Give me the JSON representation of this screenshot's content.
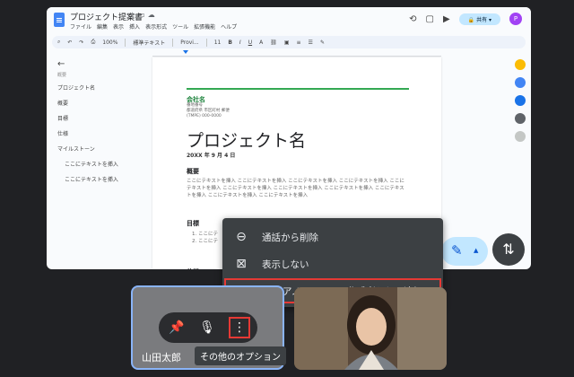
{
  "docs": {
    "title": "プロジェクト提案書",
    "menu": [
      "ファイル",
      "編集",
      "表示",
      "挿入",
      "表示形式",
      "ツール",
      "拡張機能",
      "ヘルプ"
    ],
    "share_label": "共有",
    "avatar_initial": "P",
    "toolbar": {
      "zoom": "100%",
      "style": "標準テキスト",
      "font": "Provi...",
      "font_size": "11"
    }
  },
  "outline": {
    "heading": "概要",
    "items": [
      "プロジェクト名",
      "概要",
      "目標",
      "仕様",
      "マイルストーン",
      "ここにテキストを挿入",
      "ここにテキストを挿入"
    ]
  },
  "page": {
    "company": "会社名",
    "address_lines": [
      "番地番号",
      "都道府県 市区町村 郵便",
      "(TMPE) 000-0000"
    ],
    "project_title": "プロジェクト名",
    "date": "20XX 年 9 月 4 日",
    "overview_heading": "概要",
    "overview_text": "ここにテキストを挿入 ここにテキストを挿入 ここにテキストを挿入 ここにテキストを挿入 ここにテキストを挿入 ここにテキストを挿入 ここにテキストを挿入 ここにテキストを挿入 ここにテキストを挿入 ここにテキストを挿入 ここにテキストを挿入",
    "goal_heading": "目標",
    "goal_items": [
      "1. ここにテ",
      "2. ここにテ"
    ],
    "spec_heading": "仕様"
  },
  "context_menu": {
    "items": [
      {
        "label": "通話から削除",
        "icon": "remove-circle-icon"
      },
      {
        "label": "表示しない",
        "icon": "video-off-icon"
      },
      {
        "label": "共同アノテーション作成者として追加",
        "icon": "annotate-pen-icon"
      }
    ]
  },
  "participant": {
    "name": "山田太郎",
    "tooltip": "その他のオプション"
  },
  "colors": {
    "accent_green": "#34a853",
    "highlight_red": "#e53935",
    "meet_blue": "#c2e7ff"
  }
}
